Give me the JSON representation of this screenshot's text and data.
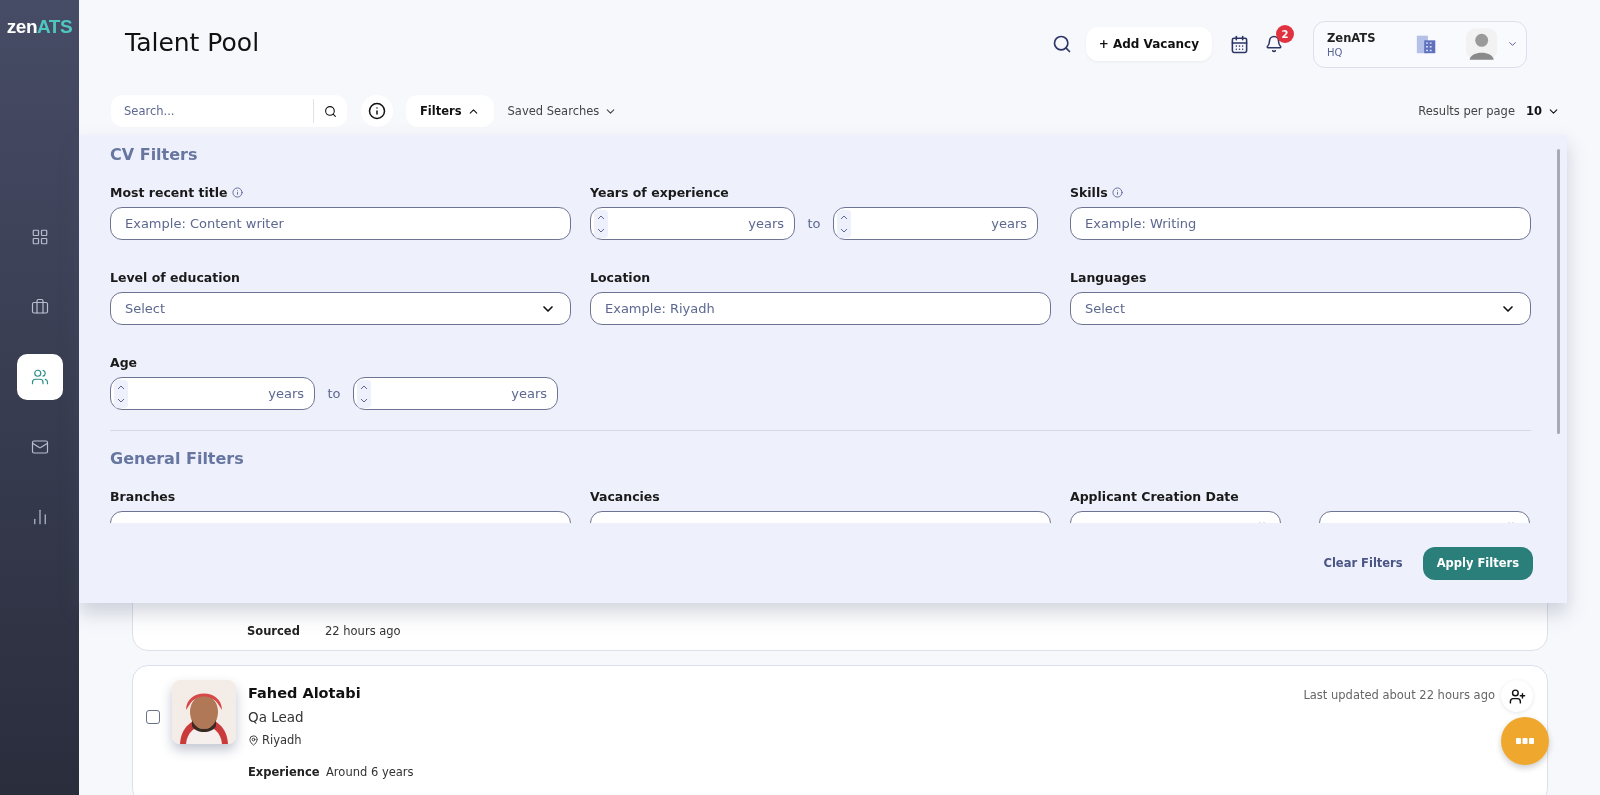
{
  "sidebar": {
    "logo": {
      "prefix": "zen",
      "suffix": "ATS"
    },
    "items": [
      {
        "selected": false
      },
      {
        "selected": false
      },
      {
        "selected": true
      },
      {
        "selected": false
      },
      {
        "selected": false
      }
    ]
  },
  "header": {
    "title": "Talent Pool",
    "add_vacancy": "+ Add Vacancy",
    "notification_count": "2",
    "account": {
      "name": "ZenATS",
      "branch": "HQ"
    }
  },
  "toolbar": {
    "search_placeholder": "Search...",
    "filters_button": "Filters",
    "filters_expanded": true,
    "saved_searches": "Saved Searches",
    "results_per_page": {
      "label": "Results per page",
      "value": "10"
    }
  },
  "filter_panel": {
    "sections": [
      {
        "title": "CV Filters",
        "fields": [
          {
            "kind": "text",
            "label": "Most recent title",
            "info": true,
            "placeholder": "Example: Content writer"
          },
          {
            "kind": "range",
            "label": "Years of experience",
            "info": false,
            "units": [
              "years",
              "years"
            ],
            "separator": "to"
          },
          {
            "kind": "text",
            "label": "Skills",
            "info": true,
            "placeholder": "Example: Writing"
          },
          {
            "kind": "select",
            "label": "Level of education",
            "info": false,
            "placeholder": "Select"
          },
          {
            "kind": "text",
            "label": "Location",
            "info": false,
            "placeholder": "Example: Riyadh"
          },
          {
            "kind": "select",
            "label": "Languages",
            "info": false,
            "placeholder": "Select"
          },
          {
            "kind": "range",
            "label": "Age",
            "info": false,
            "units": [
              "years",
              "years"
            ],
            "separator": "to"
          }
        ]
      },
      {
        "title": "General Filters",
        "fields": [
          {
            "kind": "select",
            "label": "Branches",
            "info": false
          },
          {
            "kind": "select",
            "label": "Vacancies",
            "info": false
          },
          {
            "kind": "date_range",
            "label": "Applicant Creation Date",
            "info": false
          }
        ]
      }
    ],
    "clear_button": "Clear Filters",
    "apply_button": "Apply Filters"
  },
  "candidates": [
    {
      "details": [
        {
          "label": "Sourced",
          "value": "22 hours ago"
        }
      ]
    },
    {
      "name": "Fahed Alotabi",
      "title": "Qa Lead",
      "location": "Riyadh",
      "updated": "Last updated about 22 hours ago",
      "checked": false,
      "details": [
        {
          "label": "Experience",
          "value": "Around 6 years"
        }
      ]
    }
  ]
}
